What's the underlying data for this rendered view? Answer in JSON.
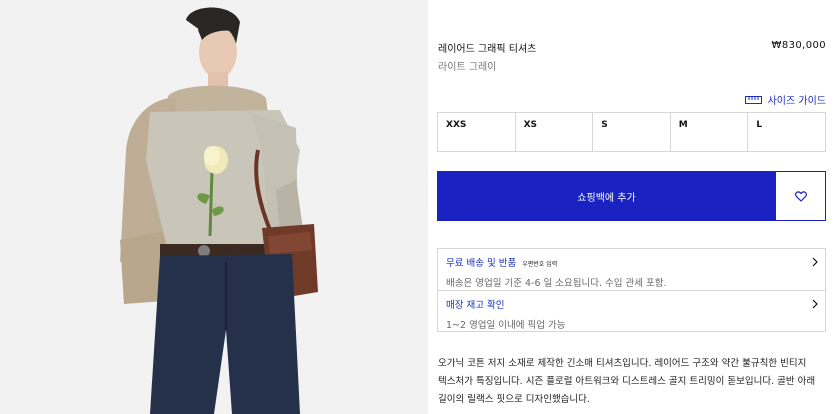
{
  "product": {
    "title": "레이어드 그래픽 티셔츠",
    "price": "₩830,000",
    "color": "라이트 그레이"
  },
  "size_guide": {
    "label": "사이즈 가이드",
    "icon": "ruler-icon"
  },
  "sizes": [
    "XXS",
    "XS",
    "S",
    "M",
    "L"
  ],
  "cart": {
    "add_label": "쇼핑백에 추가",
    "wishlist_icon": "heart-icon"
  },
  "info": {
    "shipping_title": "무료 배송 및 반품",
    "shipping_zip": "우편번호 입력",
    "shipping_text": "배송은 영업일 기준 4-6 일 소요됩니다. 수입 관세 포함.",
    "stock_title": "매장 재고 확인",
    "stock_text": "1~2 영업일 이내에 픽업 가능"
  },
  "description": "오가닉 코튼 저지 소재로 제작한 긴소매 티셔츠입니다. 레이어드 구조와 약간 불규칙한 빈티지 텍스처가 특징입니다. 시즌 플로럴 아트워크와 디스트레스 골지 트리밍이 돋보입니다. 골반 아래 길이의 릴랙스 핏으로 디자인했습니다.",
  "colors": {
    "accent": "#1a22c2",
    "link": "#1a2ec2",
    "border": "#d6d6d6"
  }
}
